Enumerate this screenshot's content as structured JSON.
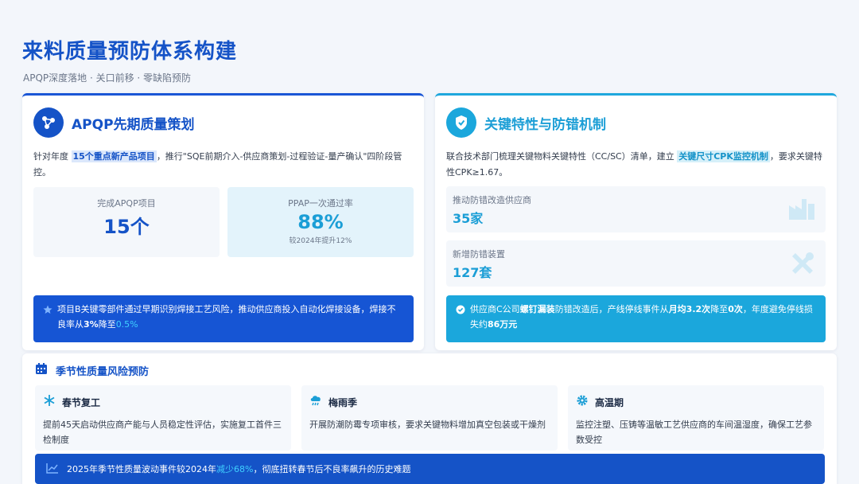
{
  "header": {
    "title": "来料质量预防体系构建",
    "subtitle": "APQP深度落地 · 关口前移 · 零缺陷预防"
  },
  "left_card": {
    "title": "APQP先期质量策划",
    "icon": "network-icon",
    "desc_prefix": "针对年度",
    "desc_highlight": "15个重点新产品项目",
    "desc_suffix": "，推行\"SQE前期介入-供应商策划-过程验证-量产确认\"四阶段管控。",
    "stat1": {
      "label": "完成APQP项目",
      "value": "15个"
    },
    "stat2": {
      "label": "PPAP一次通过率",
      "value": "88%",
      "note": "较2024年提升12%"
    },
    "banner": {
      "icon": "star-icon",
      "text_main": "项目B关键零部件通过早期识别焊接工艺风险，推动供应商投入自动化焊接设备，焊接不良率从",
      "from": "3%",
      "mid": "降至",
      "to": "0.5%"
    }
  },
  "right_card": {
    "title": "关键特性与防错机制",
    "icon": "shield-icon",
    "desc_prefix": "联合技术部门梳理关键物料关键特性（CC/SC）清单，建立",
    "desc_highlight": "关键尺寸CPK监控机制",
    "desc_suffix": "，要求关键特性CPK≥1.67。",
    "metric1": {
      "label": "推动防错改造供应商",
      "value": "35家",
      "icon": "factory-icon"
    },
    "metric2": {
      "label": "新增防错装置",
      "value": "127套",
      "icon": "tools-icon"
    },
    "banner": {
      "icon": "check-circle-icon",
      "prefix": "供应商C公司",
      "b1": "螺钉漏装",
      "p2": "防错改造后，产线停线事件从",
      "b2": "月均3.2次",
      "p3": "降至",
      "b3": "0次",
      "p4": "，年度避免停线损失约",
      "b4": "86万元"
    }
  },
  "seasonal": {
    "title": "季节性质量风险预防",
    "icon": "calendar-icon",
    "items": [
      {
        "name": "春节复工",
        "icon": "snowflake-icon",
        "text": "提前45天启动供应商产能与人员稳定性评估，实施复工首件三检制度"
      },
      {
        "name": "梅雨季",
        "icon": "rain-cloud-icon",
        "text": "开展防潮防霉专项审核，要求关键物料增加真空包装或干燥剂"
      },
      {
        "name": "高温期",
        "icon": "gear-icon",
        "text": "监控注塑、压铸等温敏工艺供应商的车间温湿度，确保工艺参数受控"
      }
    ],
    "footer": {
      "icon": "trend-chart-icon",
      "prefix": "2025年季节性质量波动事件较2024年",
      "highlight": "减少68%",
      "suffix": "，彻底扭转春节后不良率飙升的历史难题"
    }
  },
  "colors": {
    "primary": "#1553c7",
    "cyan": "#1ba7dc",
    "highlight": "#3fd0ff"
  }
}
